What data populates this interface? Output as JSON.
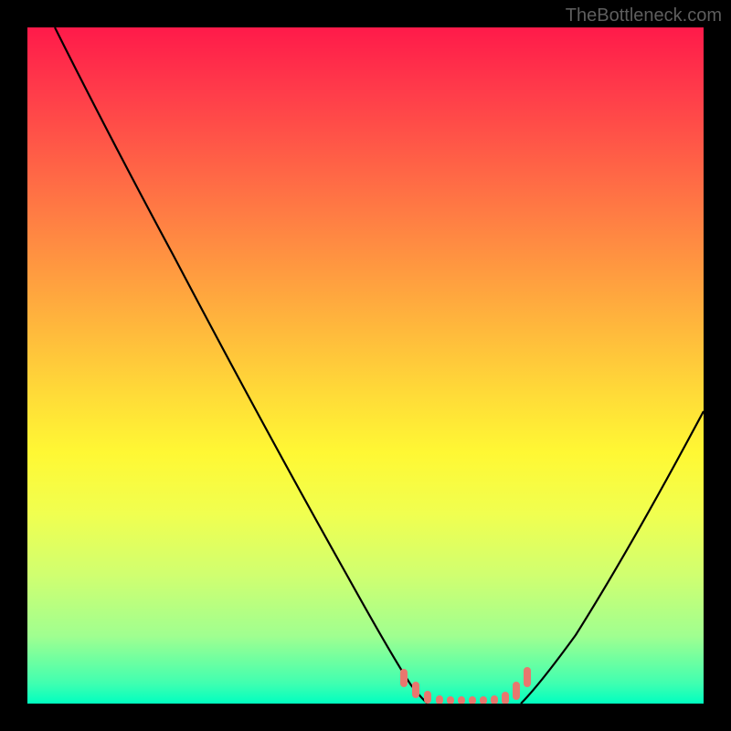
{
  "watermark": "TheBottleneck.com",
  "chart_data": {
    "type": "line",
    "title": "",
    "xlabel": "",
    "ylabel": "",
    "xlim": [
      0,
      100
    ],
    "ylim": [
      0,
      100
    ],
    "grid": false,
    "series": [
      {
        "name": "bottleneck-curve-left",
        "color": "#000000",
        "x": [
          4,
          10,
          20,
          30,
          40,
          48,
          53,
          56,
          58
        ],
        "y": [
          100,
          90,
          72,
          54,
          36,
          18,
          7,
          2,
          0
        ]
      },
      {
        "name": "bottleneck-curve-right",
        "color": "#000000",
        "x": [
          72,
          76,
          82,
          88,
          94,
          100
        ],
        "y": [
          0,
          3,
          12,
          25,
          40,
          55
        ]
      },
      {
        "name": "optimal-zone-markers",
        "color": "#e8776e",
        "x": [
          55,
          58,
          60,
          62,
          64,
          66,
          68,
          70,
          72,
          74
        ],
        "y": [
          4,
          1,
          0,
          0,
          0,
          0,
          0,
          0,
          2,
          5
        ]
      }
    ],
    "background_gradient": {
      "top": "#ff1a4a",
      "mid": "#ffe034",
      "bottom": "#00ffc0"
    }
  }
}
